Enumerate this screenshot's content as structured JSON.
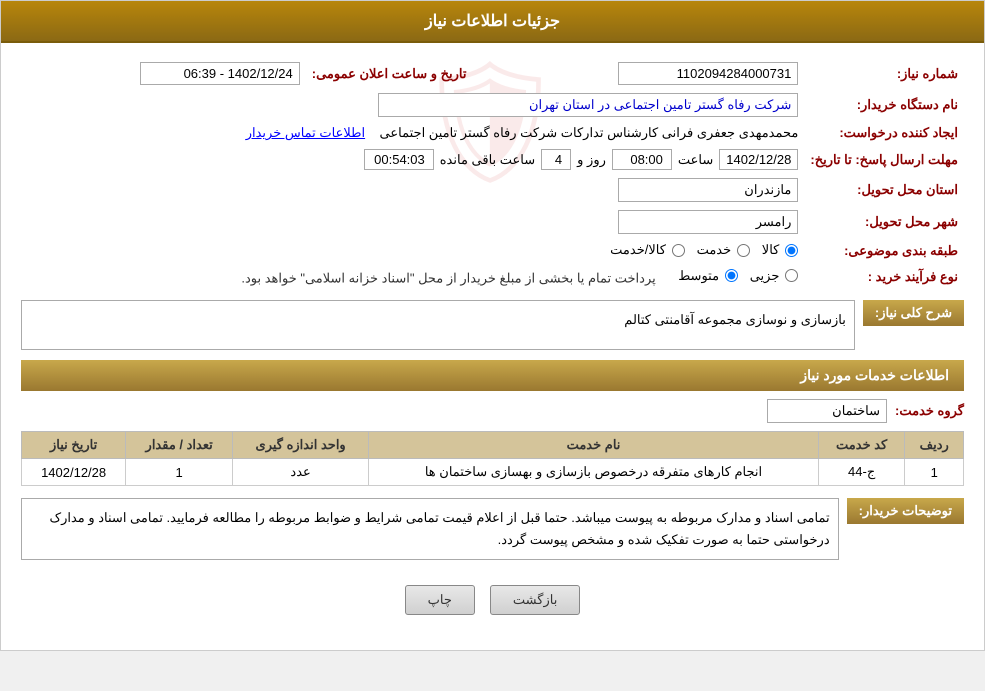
{
  "page": {
    "title": "جزئیات اطلاعات نیاز"
  },
  "header": {
    "main_title": "جزئیات اطلاعات نیاز"
  },
  "fields": {
    "need_number_label": "شماره نیاز:",
    "need_number_value": "1102094284000731",
    "buyer_name_label": "نام دستگاه خریدار:",
    "buyer_name_value": "شرکت رفاه گستر تامین اجتماعی در استان تهران",
    "creator_label": "ایجاد کننده درخواست:",
    "creator_value": "محمدمهدی جعفری فرانی کارشناس تدارکات شرکت رفاه گستر تامین اجتماعی",
    "contact_link": "اطلاعات تماس خریدار",
    "send_date_label": "مهلت ارسال پاسخ: تا تاریخ:",
    "send_date_value": "1402/12/28",
    "send_time_label": "ساعت",
    "send_time_value": "08:00",
    "send_days_label": "روز و",
    "send_days_value": "4",
    "send_remaining_label": "ساعت باقی مانده",
    "send_remaining_value": "00:54:03",
    "announce_label": "تاریخ و ساعت اعلان عمومی:",
    "announce_value": "1402/12/24 - 06:39",
    "province_label": "استان محل تحویل:",
    "province_value": "مازندران",
    "city_label": "شهر محل تحویل:",
    "city_value": "رامسر",
    "category_label": "طبقه بندی موضوعی:",
    "category_options": [
      "کالا",
      "خدمت",
      "کالا/خدمت"
    ],
    "category_selected": "کالا",
    "purchase_type_label": "نوع فرآیند خرید :",
    "purchase_type_options": [
      "جزیی",
      "متوسط"
    ],
    "purchase_type_note": "پرداخت تمام یا بخشی از مبلغ خریدار از محل \"اسناد خزانه اسلامی\" خواهد بود.",
    "description_label": "شرح کلی نیاز:",
    "description_value": "بازسازی و نوسازی مجموعه آقامنتی کتالم"
  },
  "services_section": {
    "title": "اطلاعات خدمات مورد نیاز",
    "group_label": "گروه خدمت:",
    "group_value": "ساختمان",
    "table_headers": [
      "ردیف",
      "کد خدمت",
      "نام خدمت",
      "واحد اندازه گیری",
      "تعداد / مقدار",
      "تاریخ نیاز"
    ],
    "table_rows": [
      {
        "row": "1",
        "code": "ج-44",
        "name": "انجام کارهای متفرقه درخصوص بازسازی و بهسازی ساختمان ها",
        "unit": "عدد",
        "quantity": "1",
        "date": "1402/12/28"
      }
    ]
  },
  "buyer_notes_label": "توضیحات خریدار:",
  "buyer_notes_value": "تمامی اسناد و مدارک مربوطه به پیوست میباشد. حتما قبل از اعلام قیمت تمامی شرایط و ضوابط مربوطه را مطالعه فرمایید.\nتمامی اسناد و مدارک درخواستی حتما به صورت تفکیک شده و مشخص پیوست گردد.",
  "buttons": {
    "print_label": "چاپ",
    "back_label": "بازگشت"
  }
}
